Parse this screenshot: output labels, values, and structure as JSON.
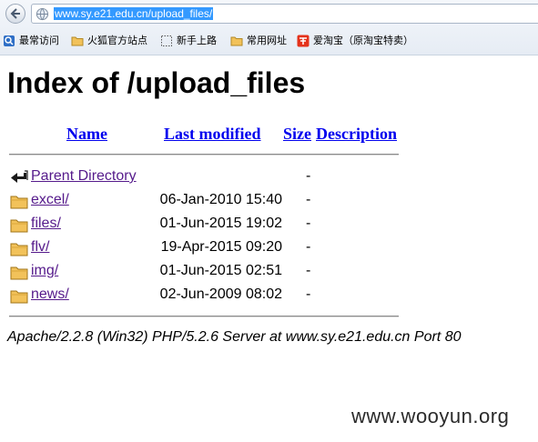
{
  "browser": {
    "address_url": "www.sy.e21.edu.cn/upload_files/",
    "bookmarks": [
      {
        "label": "最常访问",
        "icon": "most-visited-icon"
      },
      {
        "label": "火狐官方站点",
        "icon": "folder-icon"
      },
      {
        "label": "新手上路",
        "icon": "dotted-page-icon"
      },
      {
        "label": "常用网址",
        "icon": "folder-icon"
      },
      {
        "label": "爱淘宝（原淘宝特卖）",
        "icon": "taobao-icon"
      }
    ]
  },
  "page": {
    "title": "Index of /upload_files",
    "columns": {
      "name": "Name",
      "last_modified": "Last modified",
      "size": "Size",
      "description": "Description"
    },
    "parent": {
      "name": "Parent Directory",
      "size": "-",
      "icon": "back-arrow-icon"
    },
    "rows": [
      {
        "name": "excel/",
        "modified": "06-Jan-2010 15:40",
        "size": "-",
        "icon": "folder-icon"
      },
      {
        "name": "files/",
        "modified": "01-Jun-2015 19:02",
        "size": "-",
        "icon": "folder-icon"
      },
      {
        "name": "flv/",
        "modified": "19-Apr-2015 09:20",
        "size": "-",
        "icon": "folder-icon"
      },
      {
        "name": "img/",
        "modified": "01-Jun-2015 02:51",
        "size": "-",
        "icon": "folder-icon"
      },
      {
        "name": "news/",
        "modified": "02-Jun-2009 08:02",
        "size": "-",
        "icon": "folder-icon"
      }
    ],
    "server_signature": "Apache/2.2.8 (Win32) PHP/5.2.6 Server at www.sy.e21.edu.cn Port 80"
  },
  "watermark": "www.wooyun.org",
  "colors": {
    "link": "#0000ee",
    "visited_link": "#551a8b",
    "url_highlight": "#3399ff",
    "folder": "#f2c25a"
  }
}
